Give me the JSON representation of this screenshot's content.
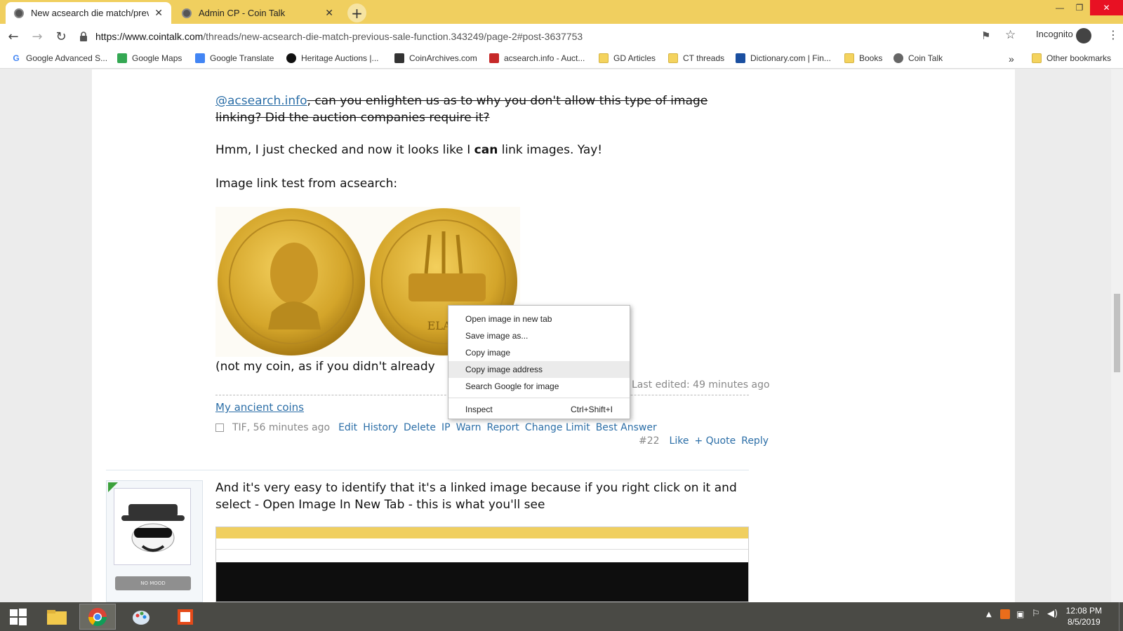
{
  "browser": {
    "tabs": [
      {
        "title": "New acsearch die match/previou",
        "active": true
      },
      {
        "title": "Admin CP - Coin Talk",
        "active": false
      }
    ],
    "new_tab_label": "+",
    "url_host": "https://www.cointalk.com",
    "url_path": "/threads/new-acsearch-die-match-previous-sale-function.343249/page-2#post-3637753",
    "incognito_label": "Incognito",
    "bookmarks": [
      {
        "label": "Google Advanced S...",
        "icon": "google-icon"
      },
      {
        "label": "Google Maps",
        "icon": "maps-icon"
      },
      {
        "label": "Google Translate",
        "icon": "translate-icon"
      },
      {
        "label": "Heritage Auctions |...",
        "icon": "heritage-icon"
      },
      {
        "label": "CoinArchives.com",
        "icon": "coinarchives-icon"
      },
      {
        "label": "acsearch.info - Auct...",
        "icon": "acsearch-icon"
      },
      {
        "label": "GD Articles",
        "icon": "folder-icon"
      },
      {
        "label": "CT threads",
        "icon": "folder-icon"
      },
      {
        "label": "Dictionary.com | Fin...",
        "icon": "dictionary-icon"
      },
      {
        "label": "Books",
        "icon": "folder-icon"
      },
      {
        "label": "Coin Talk",
        "icon": "cointalk-icon"
      }
    ],
    "overflow_label": "»",
    "other_bookmarks": "Other bookmarks"
  },
  "post1": {
    "mention": "@acsearch.info",
    "strike_rest": ", can you enlighten us as to why you don't allow this type of image",
    "strike_line2": "linking? Did the auction companies require it?",
    "para2_a": "Hmm, I just checked and now it looks like I ",
    "para2_bold": "can",
    "para2_b": " link images. Yay!",
    "para3": "Image link test from acsearch:",
    "coin_reverse_text": "ELAG",
    "caption": "(not my coin, as if you didn't already",
    "last_edited": "Last edited: 49 minutes ago",
    "signature": "My ancient coins",
    "author_time": "TIF, 56 minutes ago",
    "actions": [
      "Edit",
      "History",
      "Delete",
      "IP",
      "Warn",
      "Report",
      "Change Limit",
      "Best Answer"
    ],
    "post_number": "#22",
    "reply_actions": [
      "Like",
      "+ Quote",
      "Reply"
    ]
  },
  "context_menu": {
    "items": [
      {
        "label": "Open image in new tab",
        "shortcut": ""
      },
      {
        "label": "Save image as...",
        "shortcut": ""
      },
      {
        "label": "Copy image",
        "shortcut": ""
      },
      {
        "label": "Copy image address",
        "shortcut": "",
        "highlighted": true
      },
      {
        "label": "Search Google for image",
        "shortcut": ""
      }
    ],
    "inspect": {
      "label": "Inspect",
      "shortcut": "Ctrl+Shift+I"
    }
  },
  "post2": {
    "text_line1": "And it's very easy to identify that it's a linked image because if you right click on it and",
    "text_line2": "select - Open Image In New Tab - this is what you'll see",
    "mood_label": "NO MOOD"
  },
  "taskbar": {
    "time": "12:08 PM",
    "date": "8/5/2019"
  },
  "colors": {
    "tab_strip": "#f0cf5f",
    "link": "#2b6ea7",
    "coin_gold": "#d4a52a"
  }
}
